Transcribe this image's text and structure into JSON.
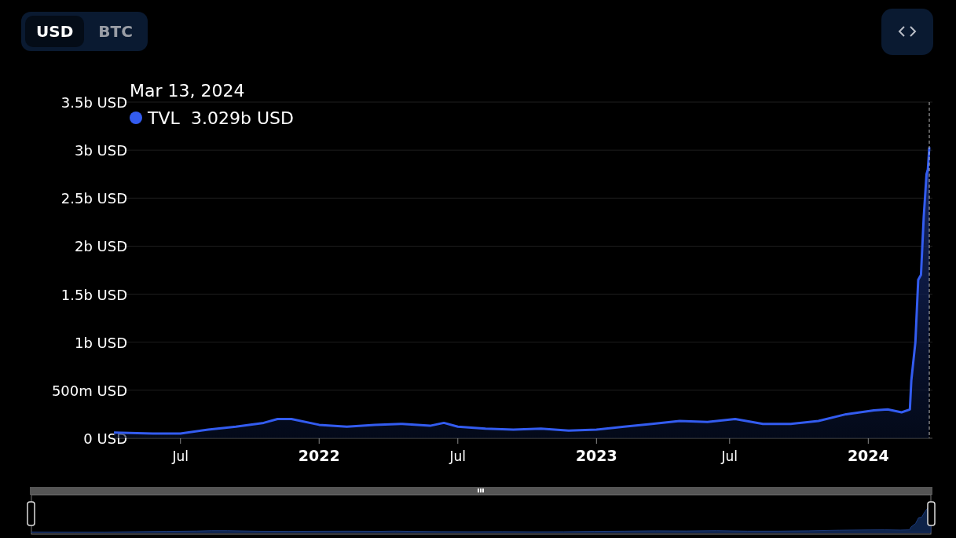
{
  "currency_toggle": [
    {
      "label": "USD",
      "selected": true
    },
    {
      "label": "BTC",
      "selected": false
    }
  ],
  "tooltip": {
    "date": "Mar 13, 2024",
    "value": "3.029b USD"
  },
  "chart_data": {
    "type": "area",
    "grid": true,
    "x": [
      2021.26,
      2021.4,
      2021.5,
      2021.6,
      2021.7,
      2021.8,
      2021.85,
      2021.9,
      2022.0,
      2022.1,
      2022.2,
      2022.3,
      2022.4,
      2022.45,
      2022.5,
      2022.6,
      2022.7,
      2022.8,
      2022.9,
      2023.0,
      2023.1,
      2023.2,
      2023.3,
      2023.4,
      2023.5,
      2023.6,
      2023.7,
      2023.8,
      2023.9,
      2024.0,
      2024.05,
      2024.1,
      2024.13,
      2024.135,
      2024.15,
      2024.16,
      2024.17,
      2024.18,
      2024.19,
      2024.195,
      2024.2
    ],
    "series": [
      {
        "name": "TVL",
        "color": "#335cf0",
        "values": [
          60000000,
          50000000,
          50000000,
          90000000,
          120000000,
          160000000,
          200000000,
          200000000,
          140000000,
          120000000,
          140000000,
          150000000,
          130000000,
          160000000,
          120000000,
          100000000,
          90000000,
          100000000,
          80000000,
          90000000,
          120000000,
          150000000,
          180000000,
          170000000,
          200000000,
          150000000,
          150000000,
          180000000,
          250000000,
          290000000,
          300000000,
          270000000,
          300000000,
          600000000,
          1000000000,
          1650000000,
          1700000000,
          2300000000,
          2750000000,
          2800000000,
          3030000000
        ]
      }
    ],
    "xlim": [
      2021.26,
      2024.2
    ],
    "ylim": [
      0,
      3500000000
    ],
    "xticks": [
      {
        "value": 2021.5,
        "label": "Jul"
      },
      {
        "value": 2022,
        "label": "2022"
      },
      {
        "value": 2022.5,
        "label": "Jul"
      },
      {
        "value": 2023,
        "label": "2023"
      },
      {
        "value": 2023.48,
        "label": "Jul"
      },
      {
        "value": 2023.98,
        "label": "2024"
      }
    ],
    "yticks": [
      {
        "value": 0,
        "label": "0 USD"
      },
      {
        "value": 500000000,
        "label": "500m USD"
      },
      {
        "value": 1000000000,
        "label": "1b USD"
      },
      {
        "value": 1500000000,
        "label": "1.5b USD"
      },
      {
        "value": 2000000000,
        "label": "2b USD"
      },
      {
        "value": 2500000000,
        "label": "2.5b USD"
      },
      {
        "value": 3000000000,
        "label": "3b USD"
      },
      {
        "value": 3500000000,
        "label": "3.5b USD"
      }
    ]
  }
}
